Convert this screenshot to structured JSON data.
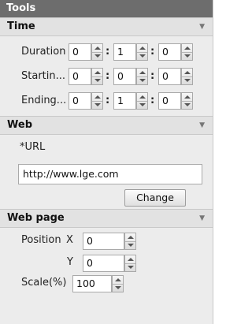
{
  "panel": {
    "title": "Tools"
  },
  "time": {
    "header": "Time",
    "rows": [
      {
        "label": "Duration",
        "h": "0",
        "m": "1",
        "s": "0"
      },
      {
        "label": "Startin...",
        "h": "0",
        "m": "0",
        "s": "0"
      },
      {
        "label": "Ending...",
        "h": "0",
        "m": "1",
        "s": "0"
      }
    ]
  },
  "web": {
    "header": "Web",
    "url_label": "*URL",
    "url_value": "http://www.lge.com",
    "change_label": "Change"
  },
  "webpage": {
    "header": "Web page",
    "position_label": "Position",
    "x_label": "X",
    "x_value": "0",
    "y_label": "Y",
    "y_value": "0",
    "scale_label": "Scale(%)",
    "scale_value": "100"
  }
}
